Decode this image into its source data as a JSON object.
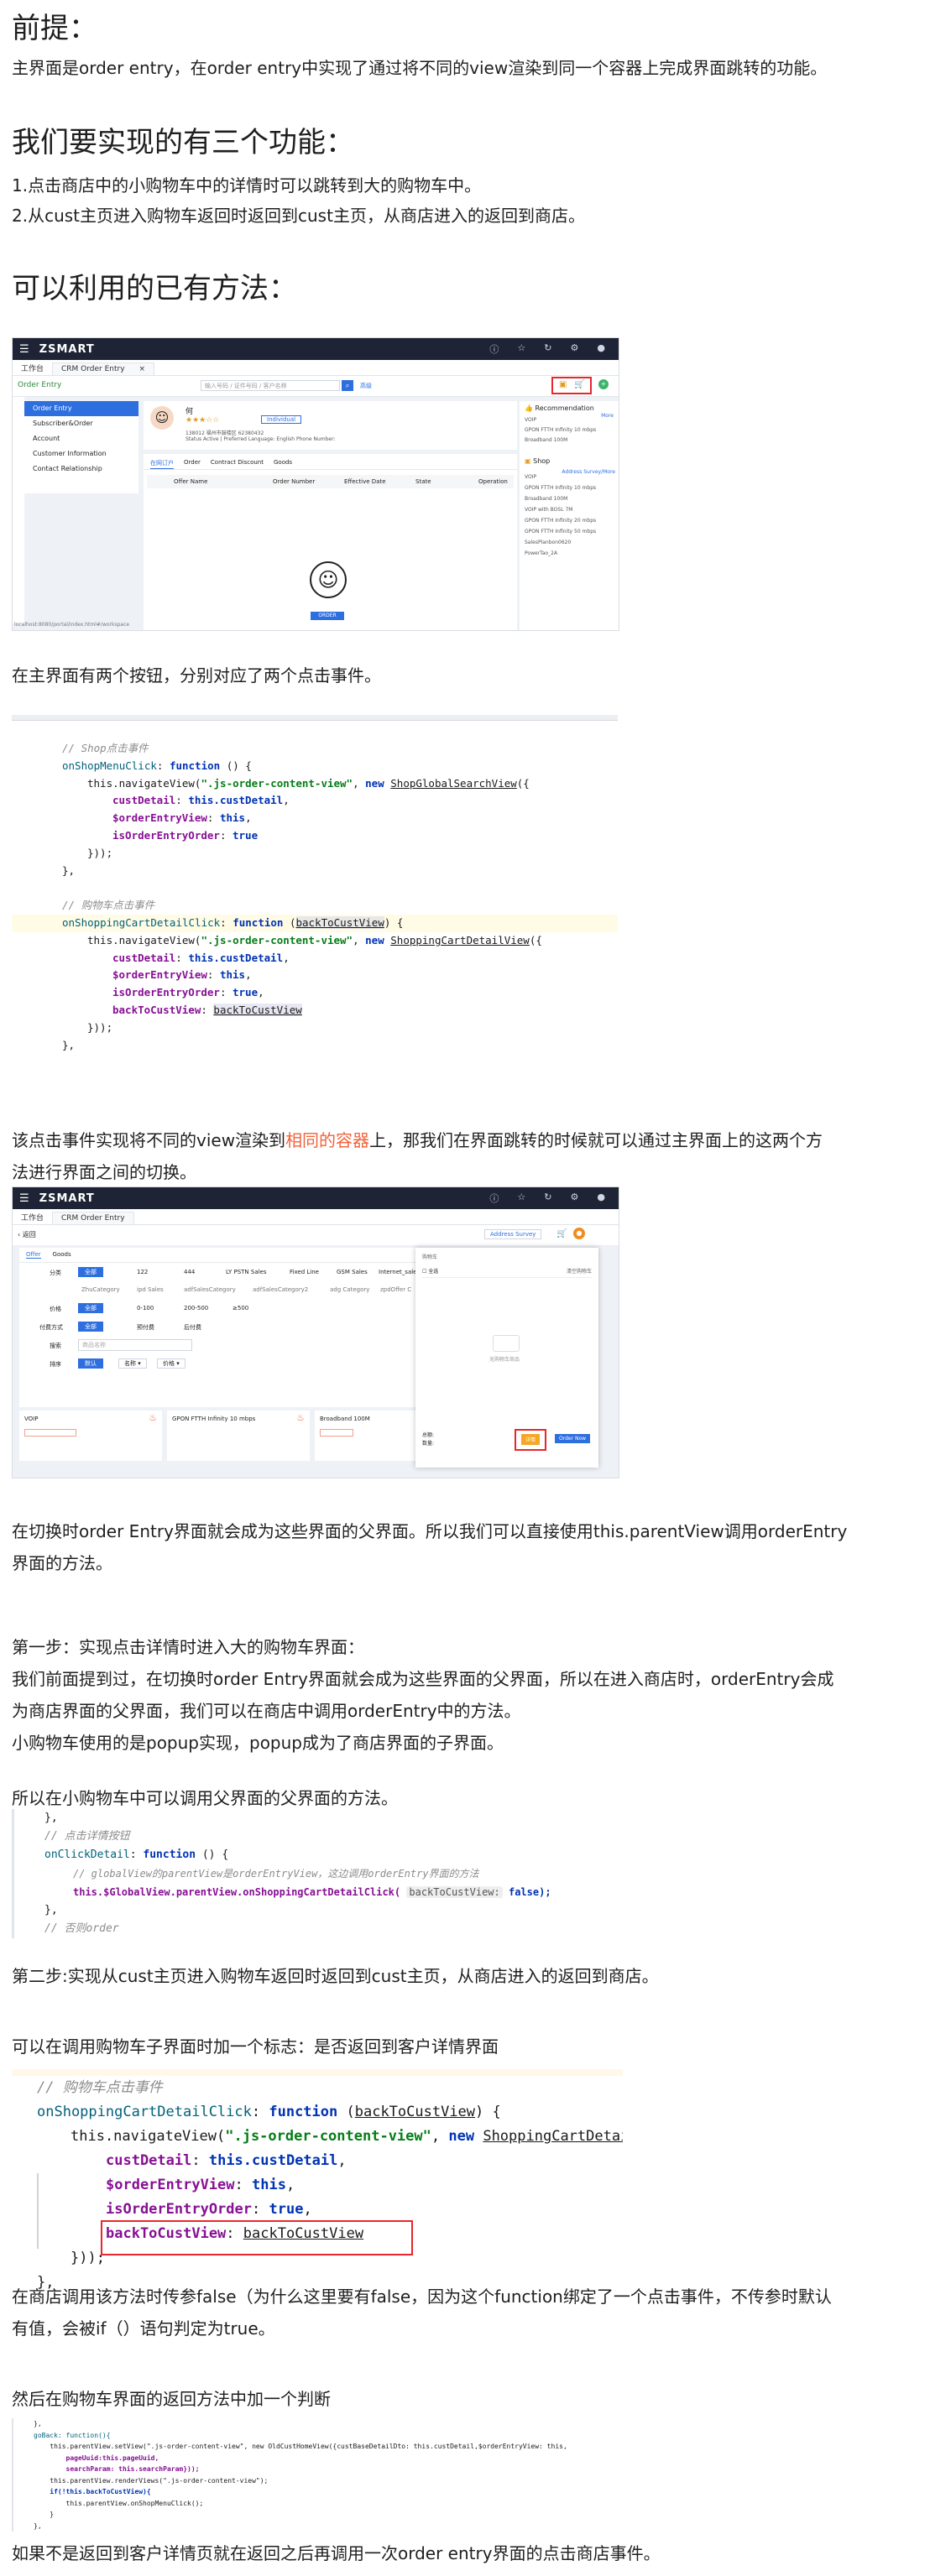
{
  "sections": {
    "premise_heading": "前提：",
    "premise_text": "主界面是order entry，在order entry中实现了通过将不同的view渲染到同一个容器上完成界面跳转的功能。",
    "features_heading": "我们要实现的有三个功能：",
    "feature_1": "1.点击商店中的小购物车中的详情时可以跳转到大的购物车中。",
    "feature_2": "2.从cust主页进入购物车返回时返回到cust主页，从商店进入的返回到商店。",
    "methods_heading": "可以利用的已有方法：",
    "buttons_text": "在主界面有两个按钮，分别对应了两个点击事件。",
    "switch_text_a": "该点击事件实现将不同的view渲染到",
    "switch_text_red": "相同的容器",
    "switch_text_b": "上，那我们在界面跳转的时候就可以通过主界面上的这两个方",
    "switch_text_c": "法进行界面之间的切换。",
    "parent_text_1": "在切换时order Entry界面就会成为这些界面的父界面。所以我们可以直接使用this.parentView调用orderEntry",
    "parent_text_2": "界面的方法。",
    "step1_title": "第一步：实现点击详情时进入大的购物车界面：",
    "step1_line1": "我们前面提到过，在切换时order Entry界面就会成为这些界面的父界面，所以在进入商店时，orderEntry会成",
    "step1_line2": "为商店界面的父界面，我们可以在商店中调用orderEntry中的方法。",
    "step1_line3": "小购物车使用的是popup实现，popup成为了商店界面的子界面。",
    "step1_line4": "所以在小购物车中可以调用父界面的父界面的方法。",
    "step2_title": "第二步:实现从cust主页进入购物车返回时返回到cust主页，从商店进入的返回到商店。",
    "flag_text": "可以在调用购物车子界面时加一个标志：是否返回到客户详情界面",
    "false_text_1": "在商店调用该方法时传参false（为什么这里要有false，因为这个function绑定了一个点击事件，不传参时默认",
    "false_text_2": "有值，会被if（）语句判定为true。",
    "back_text": "然后在购物车界面的返回方法中加一个判断",
    "final_text": "如果不是返回到客户详情页就在返回之后再调用一次order entry界面的点击商店事件。"
  },
  "shot1": {
    "brand": "ZSMART",
    "tab_workspace": "工作台",
    "tab_current": "CRM Order Entry",
    "tab_close": "×",
    "order_entry_label": "Order Entry",
    "search_placeholder": "输入号码 / 证件号码 / 客户名称",
    "search_link": "高级",
    "customer_name": "何",
    "customer_tag": "Individual",
    "customer_meta_1": "138012  福州市鼓楼区  62380432",
    "customer_meta_2": "Status Active | Preferred Language: English  Phone Number:",
    "menu": [
      "Order Entry",
      "Subscriber&Order",
      "Account",
      "Customer Information",
      "Contact Relationship"
    ],
    "subtabs": [
      "在网订户",
      "Order",
      "Contract Discount",
      "Goods"
    ],
    "columns": [
      "Offer Name",
      "Order Number",
      "Effective Date",
      "State",
      "Operation"
    ],
    "recommendation_title": "Recommendation",
    "recommendation_more": "More",
    "recommendation_items": [
      "VOIP",
      "GPON FTTH Infinity 10 mbps",
      "Broadband 100M"
    ],
    "shop_title": "Shop",
    "shop_link": "Address Survey/More",
    "shop_items": [
      "VOIP",
      "GPON FTTH Infinity 10 mbps",
      "Broadband 100M",
      "VOIP with BOSL 7M",
      "GPON FTTH Infinity 20 mbps",
      "GPON FTTH Infinity 50 mbps",
      "SalesPlanbon0620",
      "PowerTao_2A"
    ],
    "empty_button": "ORDER",
    "footer_path": "localhost:8080/portal/index.html#/workspace"
  },
  "code1": {
    "c_shop": "// Shop点击事件",
    "shop_fn": "onShopMenuClick",
    "kw_function": "function",
    "navigate": "this.navigateView(",
    "container": "\".js-order-content-view\"",
    "kw_new": "new",
    "view_shop": "ShopGlobalSearchView",
    "p_cust": "custDetail",
    "v_cust": "this.custDetail",
    "p_entry": "$orderEntryView",
    "v_this": "this",
    "p_isorder": "isOrderEntryOrder",
    "v_true": "true",
    "c_cart": "// 购物车点击事件",
    "cart_fn": "onShoppingCartDetailClick",
    "param": "backToCustView",
    "view_cart": "ShoppingCartDetailView",
    "p_back": "backToCustView"
  },
  "shot2": {
    "brand": "ZSMART",
    "tab_workspace": "工作台",
    "tab_current": "CRM Order Entry",
    "back_label": "返回",
    "address_btn": "Address Survey",
    "subtabs": [
      "Offer",
      "Goods"
    ],
    "filter_row1_label": "分类",
    "filter_row1": [
      "全部",
      "122",
      "444",
      "LY PSTN Sales",
      "Fixed Line",
      "GSM Sales",
      "Internet_sale"
    ],
    "filter_row1b": [
      "ZhuCategory",
      "ipd Sales",
      "adfSalesCategory",
      "adfSalesCategory2",
      "adg Category",
      "zpdOffer C"
    ],
    "filter_row2_label": "价格",
    "filter_row2": [
      "全部",
      "0-100",
      "200-500",
      "≥500"
    ],
    "filter_row3_label": "付费方式",
    "filter_row3": [
      "全部",
      "预付费",
      "后付费"
    ],
    "filter_row4_label": "搜索",
    "filter_row4_placeholder": "商品名称",
    "sort_label": "排序",
    "sort_items": [
      "默认",
      "名称 ▾",
      "价格 ▾"
    ],
    "cards": [
      "VOIP",
      "GPON FTTH Infinity 10 mbps",
      "Broadband 100M"
    ],
    "popup_title": "购物车",
    "popup_select_all": "全选",
    "popup_clear": "清空购物车",
    "popup_empty": "无购物车商品",
    "popup_total": "总额:",
    "popup_count": "数量:",
    "popup_detail": "详情",
    "popup_order_now": "Order Now"
  },
  "code2": {
    "c1": "// 点击详情按钮",
    "fn": "onClickDetail",
    "c2": "// globalView的parentView是orderEntryView，这边调用orderEntry界面的方法",
    "call_a": "this.$GlobalView.parentView.onShoppingCartDetailClick(",
    "hint": "backToCustView:",
    "call_b": "false);",
    "c3": "// 否则order"
  },
  "code3": {
    "c_cart": "// 购物车点击事件"
  },
  "code4": {
    "line1": "},",
    "line2": "goBack: function(){",
    "line3": "    this.parentView.setView(\".js-order-content-view\", new OldCustHomeView({custBaseDetailDto: this.custDetail,$orderEntryView: this,",
    "line4": "        pageUuid:this.pageUuid,",
    "line5": "        searchParam: this.searchParam}));",
    "line6": "    this.parentView.renderViews(\".js-order-content-view\");",
    "line7": "    if(!this.backToCustView){",
    "line8": "        this.parentView.onShopMenuClick();",
    "line9": "    }",
    "line10": "},"
  },
  "colors": {
    "topbar": "#1e2435",
    "accent_blue": "#2e6fe0",
    "keyword": "#0033b3",
    "string": "#067d17",
    "property": "#871094",
    "highlight_red": "#e8262b",
    "text_red": "#f2623a"
  }
}
